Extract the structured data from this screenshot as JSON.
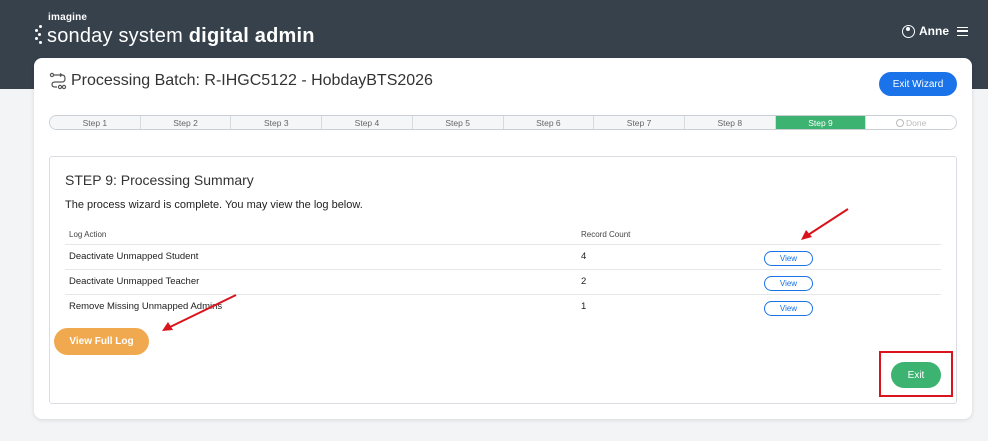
{
  "brand": {
    "small": "imagine",
    "name_light": "sonday system",
    "name_bold": "digital admin"
  },
  "user": {
    "name": "Anne"
  },
  "header": {
    "title": "Processing Batch: R-IHGC5122 - HobdayBTS2026",
    "exit_wizard": "Exit Wizard"
  },
  "steps": [
    "Step 1",
    "Step 2",
    "Step 3",
    "Step 4",
    "Step 5",
    "Step 6",
    "Step 7",
    "Step 8",
    "Step 9",
    "Done"
  ],
  "active_step": "Step 9",
  "summary": {
    "title": "STEP 9: Processing Summary",
    "message": "The process wizard is complete. You may view the log below.",
    "columns": {
      "action": "Log Action",
      "count": "Record Count"
    },
    "rows": [
      {
        "action": "Deactivate Unmapped Student",
        "count": "4",
        "view": "View"
      },
      {
        "action": "Deactivate Unmapped Teacher",
        "count": "2",
        "view": "View"
      },
      {
        "action": "Remove Missing Unmapped Admins",
        "count": "1",
        "view": "View"
      }
    ],
    "view_full_log": "View Full Log",
    "exit": "Exit"
  },
  "colors": {
    "topbar": "#36414c",
    "primary": "#1a73e8",
    "active_step": "#3cb371",
    "orange": "#f0a94e",
    "annotation": "#d9141d"
  }
}
